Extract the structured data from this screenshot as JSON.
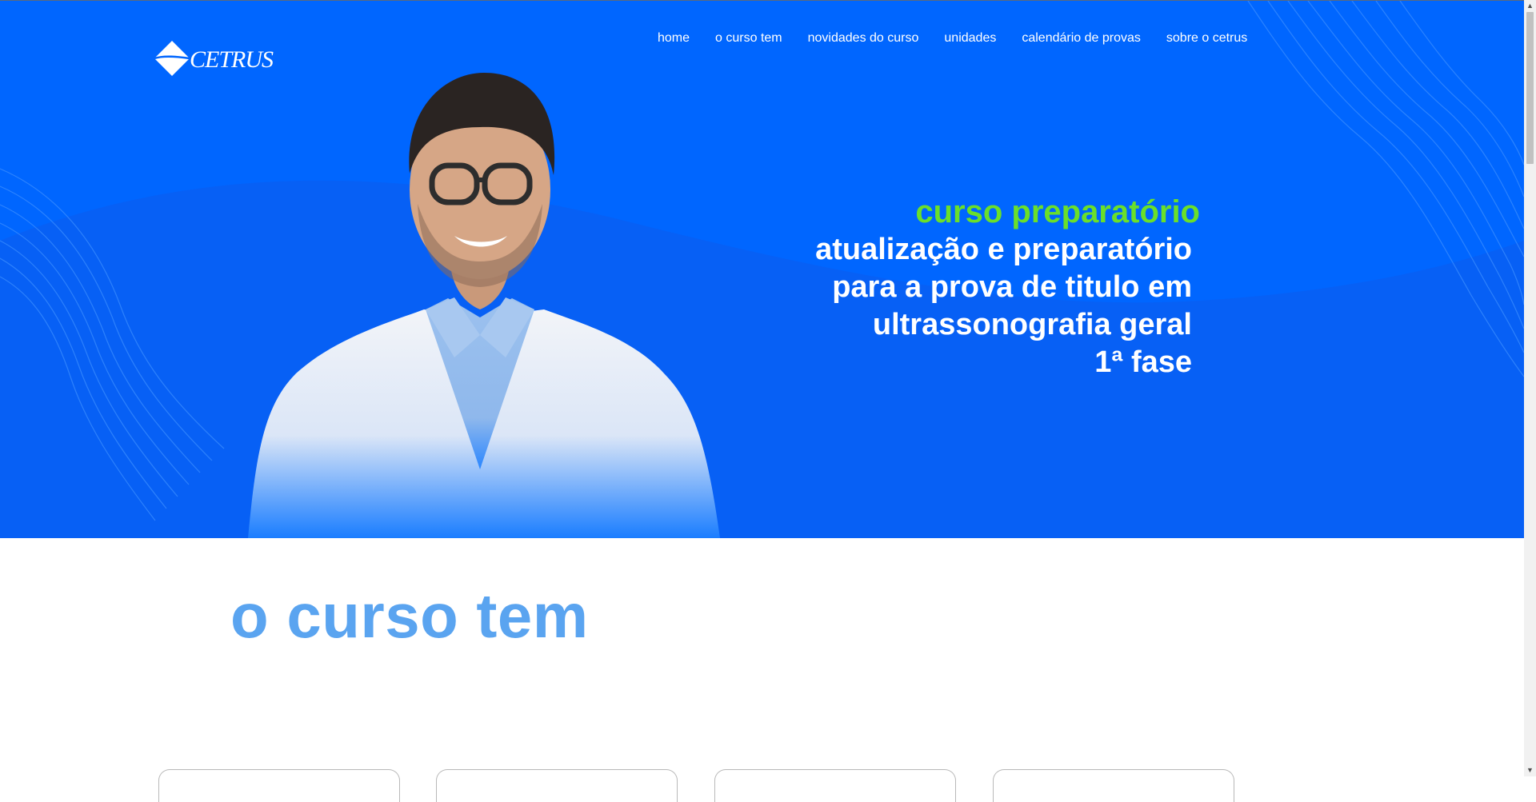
{
  "brand": {
    "logo_text": "CETRUS"
  },
  "nav": {
    "items": [
      {
        "label": "home"
      },
      {
        "label": "o curso tem"
      },
      {
        "label": "novidades do curso"
      },
      {
        "label": "unidades"
      },
      {
        "label": "calendário de provas"
      },
      {
        "label": "sobre o cetrus"
      }
    ]
  },
  "hero": {
    "kicker": "curso preparatório",
    "lines": [
      "atualização e preparatório",
      "para a prova de titulo em",
      "ultrassonografia geral",
      "1ª fase"
    ],
    "colors": {
      "background": "#0066ff",
      "accent": "#6adf2a"
    }
  },
  "section": {
    "title": "o curso tem",
    "title_color": "#5aa4f0"
  }
}
